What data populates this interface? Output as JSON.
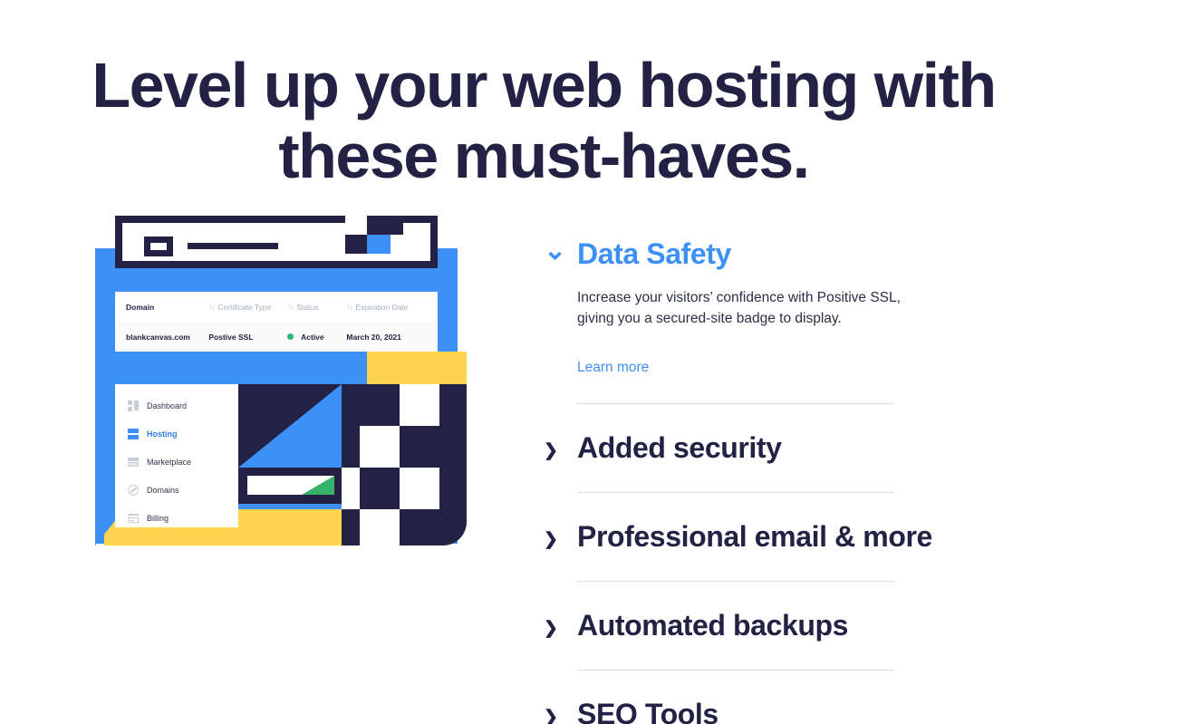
{
  "page": {
    "headline": "Level up your web hosting with\nthese must-haves."
  },
  "colors": {
    "navy": "#232244",
    "blue": "#3D90F5",
    "yellow": "#FFD44F",
    "green": "#2EB872",
    "muted": "#A7AEBB",
    "divider": "#D8DCE3"
  },
  "illustration": {
    "browser": {
      "address_bar_name": "address-bar"
    },
    "ssl_table": {
      "columns": [
        {
          "label": "Domain",
          "sortable": false
        },
        {
          "label": "Certificate Type",
          "sortable": true
        },
        {
          "label": "Status",
          "sortable": true
        },
        {
          "label": "Expiration Date",
          "sortable": true
        }
      ],
      "sort_icon": "↑↓",
      "rows": [
        {
          "domain": "blankcanvas.com",
          "certificate_type": "Postive SSL",
          "status": "Active",
          "status_color": "#2EB872",
          "expiration_date": "March 20, 2021"
        }
      ]
    },
    "sidebar": {
      "items": [
        {
          "label": "Dashboard",
          "icon": "dashboard-icon",
          "active": false
        },
        {
          "label": "Hosting",
          "icon": "server-icon",
          "active": true
        },
        {
          "label": "Marketplace",
          "icon": "store-icon",
          "active": false
        },
        {
          "label": "Domains",
          "icon": "globe-icon",
          "active": false
        },
        {
          "label": "Billing",
          "icon": "credit-card-icon",
          "active": false
        }
      ]
    }
  },
  "accordion": {
    "items": [
      {
        "title": "Data Safety",
        "expanded": true,
        "chevron": "chevron-down-icon",
        "description": "Increase your visitors’ confidence with Positive SSL,\ngiving you a secured-site badge to display.",
        "link_label": "Learn more"
      },
      {
        "title": "Added security",
        "expanded": false,
        "chevron": "chevron-right-icon"
      },
      {
        "title": "Professional email & more",
        "expanded": false,
        "chevron": "chevron-right-icon"
      },
      {
        "title": "Automated backups",
        "expanded": false,
        "chevron": "chevron-right-icon"
      },
      {
        "title": "SEO Tools",
        "expanded": false,
        "chevron": "chevron-right-icon"
      }
    ]
  }
}
